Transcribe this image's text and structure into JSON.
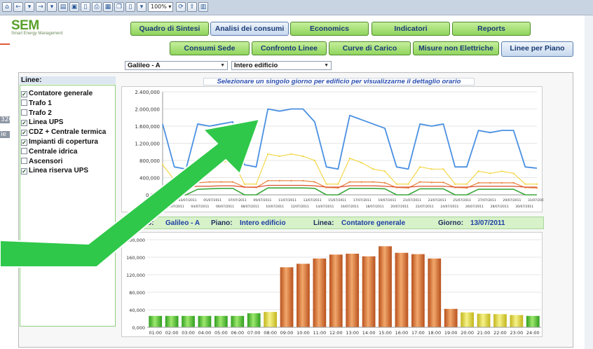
{
  "toolbar": {
    "zoom": "100%",
    "buttons": [
      "home-icon",
      "back-icon",
      "dropdown-icon",
      "forward-icon",
      "dropdown-icon",
      "open-folder-icon",
      "save-icon",
      "document-icon",
      "print-icon",
      "print-preview-icon",
      "copy-icon",
      "page-icon",
      "dropdown-icon",
      "zoom-dropdown",
      "refresh-icon",
      "export-icon",
      "chart-icon"
    ]
  },
  "behind_panel": {
    "fragments": [
      "320",
      "ie"
    ]
  },
  "logo": {
    "title": "SEM",
    "subtitle": "Smart Energy Management"
  },
  "nav": {
    "main_tabs": [
      {
        "label": "Quadro di Sintesi",
        "active": false
      },
      {
        "label": "Analisi dei consumi",
        "active": true
      },
      {
        "label": "Economics",
        "active": false
      },
      {
        "label": "Indicatori",
        "active": false
      },
      {
        "label": "Reports",
        "active": false
      }
    ],
    "sub_tabs": [
      {
        "label": "Consumi Sede",
        "active": false
      },
      {
        "label": "Confronto Linee",
        "active": false
      },
      {
        "label": "Curve di Carico",
        "active": false
      },
      {
        "label": "Misure non Elettriche",
        "active": false
      },
      {
        "label": "Linee per Piano",
        "active": true
      }
    ]
  },
  "filters": {
    "building": "Galileo - A",
    "floor": "Intero edificio"
  },
  "lines_panel": {
    "title": "Linee:",
    "items": [
      {
        "label": "Contatore generale",
        "checked": true
      },
      {
        "label": "Trafo 1",
        "checked": false
      },
      {
        "label": "Trafo 2",
        "checked": false
      },
      {
        "label": "Linea UPS",
        "checked": true
      },
      {
        "label": "CDZ + Centrale termica",
        "checked": true
      },
      {
        "label": "Impianti di copertura",
        "checked": true
      },
      {
        "label": "Centrale idrica",
        "checked": false
      },
      {
        "label": "Ascensori",
        "checked": false
      },
      {
        "label": "Linea riserva UPS",
        "checked": true
      }
    ]
  },
  "hint": "Selezionare un singolo giorno per edificio per visualizzarne il dettaglio orario",
  "infobar": {
    "building_label": "Edificio:",
    "building_value": "Galileo - A",
    "floor_label": "Piano:",
    "floor_value": "Intero edificio",
    "line_label": "Linea:",
    "line_value": "Contatore generale",
    "day_label": "Giorno:",
    "day_value": "13/07/2011"
  },
  "colors": {
    "tab_green": "#8fd45c",
    "arrow_green": "#2fc84a",
    "series": [
      "#4a90e2",
      "#f2d43a",
      "#e8803a",
      "#d9502e",
      "#3aa83a"
    ]
  },
  "chart_data": [
    {
      "type": "line",
      "title": "",
      "ylim": [
        0,
        2400000
      ],
      "yticks": [
        "0,000",
        "400,000",
        "800,000",
        "1.200,000",
        "1.600,000",
        "2.000,000",
        "2.400,000"
      ],
      "x_top": [
        "01/07/2011",
        "03/07/2011",
        "05/07/2011",
        "07/07/2011",
        "09/07/2011",
        "11/07/2011",
        "13/07/2011",
        "15/07/2011",
        "17/07/2011",
        "19/07/2011",
        "21/07/2011",
        "23/07/2011",
        "25/07/2011",
        "27/07/2011",
        "29/07/2011",
        "31/07/2011"
      ],
      "x_bottom": [
        "02/07/2011",
        "04/07/2011",
        "06/07/2011",
        "08/07/2011",
        "10/07/2011",
        "12/07/2011",
        "14/07/2011",
        "16/07/2011",
        "18/07/2011",
        "20/07/2011",
        "22/07/2011",
        "24/07/2011",
        "26/07/2011",
        "28/07/2011",
        "30/07/2011"
      ],
      "x": [
        1,
        2,
        3,
        4,
        5,
        6,
        7,
        8,
        9,
        10,
        11,
        12,
        13,
        14,
        15,
        16,
        17,
        18,
        19,
        20,
        21,
        22,
        23,
        24,
        25,
        26,
        27,
        28,
        29,
        30,
        31
      ],
      "series": [
        {
          "values": [
            1650000,
            650000,
            600000,
            1650000,
            1600000,
            1650000,
            1700000,
            700000,
            650000,
            2000000,
            1950000,
            2000000,
            2000000,
            1700000,
            650000,
            600000,
            1850000,
            1750000,
            1650000,
            1550000,
            650000,
            600000,
            1650000,
            1600000,
            1650000,
            650000,
            650000,
            1500000,
            1450000,
            1500000,
            1500000,
            650000,
            620000
          ]
        },
        {
          "values": [
            700000,
            350000,
            250000,
            600000,
            700000,
            750000,
            800000,
            250000,
            250000,
            950000,
            900000,
            950000,
            900000,
            800000,
            250000,
            250000,
            850000,
            750000,
            600000,
            550000,
            250000,
            250000,
            650000,
            600000,
            600000,
            250000,
            250000,
            550000,
            500000,
            550000,
            500000,
            250000,
            250000
          ]
        },
        {
          "values": [
            200000,
            150000,
            150000,
            280000,
            300000,
            300000,
            300000,
            180000,
            170000,
            330000,
            330000,
            330000,
            330000,
            300000,
            170000,
            160000,
            300000,
            300000,
            300000,
            280000,
            170000,
            160000,
            300000,
            290000,
            290000,
            170000,
            160000,
            280000,
            280000,
            280000,
            280000,
            170000,
            160000
          ]
        },
        {
          "values": [
            180000,
            170000,
            170000,
            200000,
            200000,
            210000,
            210000,
            180000,
            180000,
            220000,
            220000,
            220000,
            220000,
            210000,
            180000,
            180000,
            210000,
            210000,
            210000,
            200000,
            180000,
            180000,
            200000,
            200000,
            200000,
            180000,
            180000,
            200000,
            200000,
            200000,
            200000,
            180000,
            180000
          ]
        },
        {
          "values": [
            150000,
            0,
            0,
            130000,
            140000,
            150000,
            150000,
            0,
            0,
            160000,
            160000,
            160000,
            160000,
            150000,
            0,
            0,
            150000,
            150000,
            150000,
            140000,
            0,
            0,
            140000,
            140000,
            140000,
            0,
            0,
            130000,
            130000,
            130000,
            130000,
            0,
            0
          ]
        }
      ]
    },
    {
      "type": "bar",
      "title": "",
      "ylim": [
        0,
        200000
      ],
      "yticks": [
        "0,000",
        "40,000",
        "80,000",
        "120,000",
        "160,000",
        "200,000"
      ],
      "categories": [
        "01:00",
        "02:00",
        "03:00",
        "04:00",
        "05:00",
        "06:00",
        "07:00",
        "08:00",
        "09:00",
        "10:00",
        "11:00",
        "12:00",
        "13:00",
        "14:00",
        "15:00",
        "16:00",
        "17:00",
        "18:00",
        "19:00",
        "20:00",
        "21:00",
        "22:00",
        "23:00",
        "24:00"
      ],
      "values": [
        26000,
        26000,
        26000,
        26000,
        26000,
        26000,
        32000,
        35000,
        137000,
        145000,
        157000,
        166000,
        168000,
        162000,
        185000,
        170000,
        167000,
        157000,
        42000,
        34000,
        31000,
        30000,
        28000,
        26000
      ],
      "bar_colors": [
        "green",
        "green",
        "green",
        "green",
        "green",
        "green",
        "green",
        "yellow",
        "orange",
        "orange",
        "orange",
        "orange",
        "orange",
        "orange",
        "orange",
        "orange",
        "orange",
        "orange",
        "orange",
        "yellow",
        "yellow",
        "yellow",
        "yellow",
        "green"
      ]
    }
  ]
}
